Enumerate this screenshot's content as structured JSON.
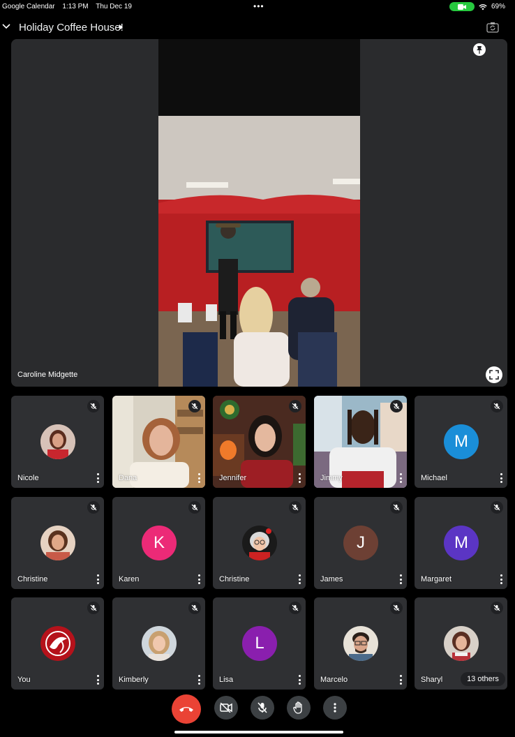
{
  "status_bar": {
    "app": "Google Calendar",
    "time": "1:13 PM",
    "date": "Thu Dec 19",
    "battery": "69%"
  },
  "meeting": {
    "title": "Holiday Coffee House!"
  },
  "spotlight": {
    "name": "Caroline Midgette"
  },
  "participants": [
    {
      "name": "Nicole",
      "avatar": "photo",
      "muted": true
    },
    {
      "name": "Dana",
      "avatar": "video",
      "muted": true
    },
    {
      "name": "Jennifer",
      "avatar": "video",
      "muted": true
    },
    {
      "name": "Jimmy",
      "avatar": "video",
      "muted": true
    },
    {
      "name": "Michael",
      "avatar": "letter",
      "initial": "M",
      "color": "#1a8ed8",
      "muted": true
    },
    {
      "name": "Christine",
      "avatar": "photo",
      "muted": true
    },
    {
      "name": "Karen",
      "avatar": "letter",
      "initial": "K",
      "color": "#ec2a77",
      "muted": true
    },
    {
      "name": "Christine",
      "avatar": "photo",
      "muted": true
    },
    {
      "name": "James",
      "avatar": "letter",
      "initial": "J",
      "color": "#6d4034",
      "muted": true
    },
    {
      "name": "Margaret",
      "avatar": "letter",
      "initial": "M",
      "color": "#5b35c4",
      "muted": true
    },
    {
      "name": "You",
      "avatar": "logo",
      "muted": true
    },
    {
      "name": "Kimberly",
      "avatar": "photo",
      "muted": true
    },
    {
      "name": "Lisa",
      "avatar": "letter",
      "initial": "L",
      "color": "#8a1fae",
      "muted": true
    },
    {
      "name": "Marcelo",
      "avatar": "photo",
      "muted": true
    },
    {
      "name": "Sharyl",
      "avatar": "photo",
      "muted": true
    }
  ],
  "others_label": "13 others",
  "controls": [
    "end-call",
    "camera-off",
    "mic-off",
    "raise-hand",
    "more-options"
  ],
  "colors": {
    "end_call": "#ea4335",
    "tile": "#2f3033",
    "background": "#000000",
    "camera_on": "#27c93f"
  }
}
